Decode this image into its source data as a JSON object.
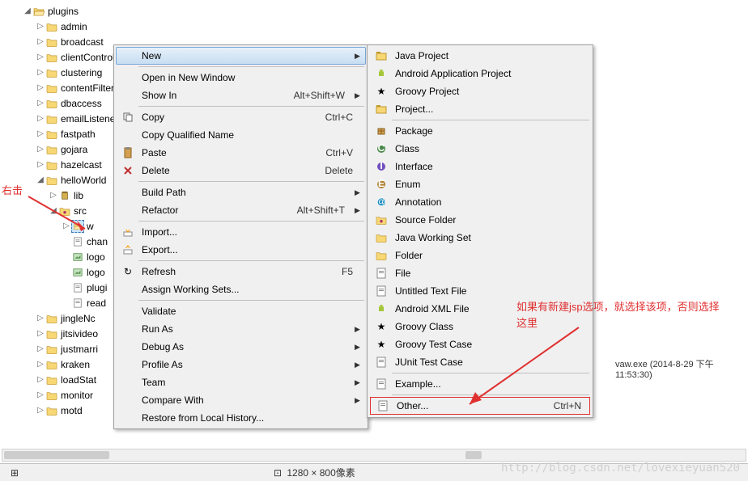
{
  "tree": {
    "root": "plugins",
    "items": [
      "admin",
      "broadcast",
      "clientControl",
      "clustering",
      "contentFilter",
      "dbaccess",
      "emailListener",
      "fastpath",
      "gojara",
      "hazelcast",
      "helloWorld",
      "lib"
    ],
    "src_node": "src",
    "src_children": [
      "w",
      "chan",
      "logo",
      "logo",
      "plugi",
      "read"
    ],
    "after": [
      "jingleNc",
      "jitsivideo",
      "justmarri",
      "kraken",
      "loadStat",
      "monitor",
      "motd"
    ]
  },
  "menu": {
    "new": "New",
    "open_window": "Open in New Window",
    "show_in": "Show In",
    "show_in_sc": "Alt+Shift+W",
    "copy": "Copy",
    "copy_sc": "Ctrl+C",
    "copy_qname": "Copy Qualified Name",
    "paste": "Paste",
    "paste_sc": "Ctrl+V",
    "delete": "Delete",
    "delete_sc": "Delete",
    "build_path": "Build Path",
    "refactor": "Refactor",
    "refactor_sc": "Alt+Shift+T",
    "import": "Import...",
    "export": "Export...",
    "refresh": "Refresh",
    "refresh_sc": "F5",
    "assign_ws": "Assign Working Sets...",
    "validate": "Validate",
    "run_as": "Run As",
    "debug_as": "Debug As",
    "profile_as": "Profile As",
    "team": "Team",
    "compare": "Compare With",
    "restore": "Restore from Local History..."
  },
  "submenu": {
    "java_project": "Java Project",
    "android_app": "Android Application Project",
    "groovy_project": "Groovy Project",
    "project": "Project...",
    "package": "Package",
    "class": "Class",
    "interface": "Interface",
    "enum": "Enum",
    "annotation": "Annotation",
    "source_folder": "Source Folder",
    "working_set": "Java Working Set",
    "folder": "Folder",
    "file": "File",
    "untitled_text": "Untitled Text File",
    "android_xml": "Android XML File",
    "groovy_class": "Groovy Class",
    "groovy_test": "Groovy Test Case",
    "junit_test": "JUnit Test Case",
    "example": "Example...",
    "other": "Other...",
    "other_sc": "Ctrl+N"
  },
  "annotations": {
    "left": "右击",
    "right": "如果有新建jsp选项，就选择该项，否则选择这里"
  },
  "status": {
    "dimensions": "1280 × 800像素"
  },
  "file_detail": "vaw.exe (2014-8-29 下午11:53:30)",
  "watermark": "http://blog.csdn.net/lovexieyuan520"
}
